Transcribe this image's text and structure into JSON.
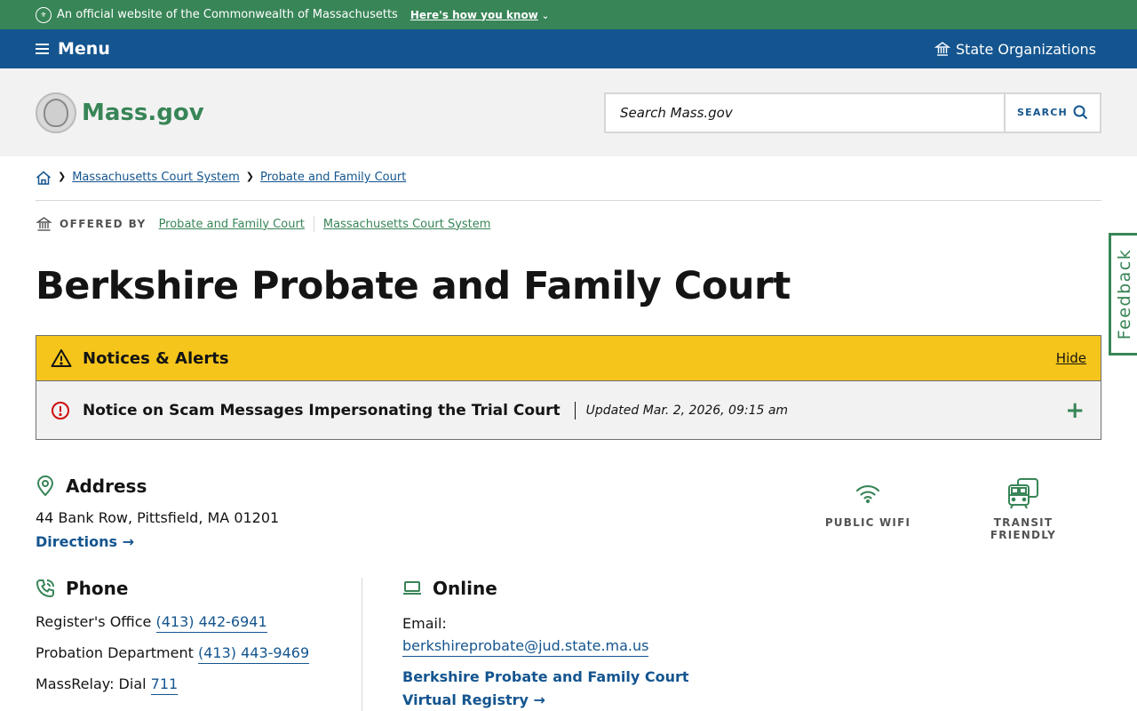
{
  "official_banner": {
    "text": "An official website of the Commonwealth of Massachusetts",
    "how_link": "Here's how you know"
  },
  "nav": {
    "menu_label": "Menu",
    "state_orgs_label": "State Organizations"
  },
  "header": {
    "logo_text": "Mass.gov",
    "search_placeholder": "Search Mass.gov",
    "search_button": "SEARCH"
  },
  "breadcrumb": {
    "items": [
      "Massachusetts Court System",
      "Probate and Family Court"
    ]
  },
  "offered_by": {
    "label": "OFFERED BY",
    "orgs": [
      "Probate and Family Court",
      "Massachusetts Court System"
    ]
  },
  "page": {
    "title": "Berkshire Probate and Family Court"
  },
  "alerts": {
    "title": "Notices & Alerts",
    "hide_label": "Hide",
    "items": [
      {
        "title": "Notice on Scam Messages Impersonating the Trial Court",
        "updated": "Updated Mar. 2, 2026, 09:15 am",
        "expand": "+"
      }
    ]
  },
  "address": {
    "heading": "Address",
    "line": "44 Bank Row, Pittsfield, MA 01201",
    "directions": "Directions →"
  },
  "amenities": [
    {
      "label": "PUBLIC WIFI",
      "icon": "wifi-icon"
    },
    {
      "label": "TRANSIT FRIENDLY",
      "icon": "transit-icon"
    }
  ],
  "phone": {
    "heading": "Phone",
    "rows": [
      {
        "label": "Register's Office",
        "number": "(413) 442-6941"
      },
      {
        "label": "Probation Department",
        "number": "(413) 443-9469"
      },
      {
        "label": "MassRelay: Dial",
        "number": "711"
      }
    ]
  },
  "online": {
    "heading": "Online",
    "email_label": "Email:",
    "email": "berkshireprobate@jud.state.ma.us",
    "registry_line1": "Berkshire Probate and Family Court",
    "registry_line2": "Virtual Registry →"
  },
  "feedback": {
    "label": "Feedback"
  },
  "colors": {
    "green": "#388557",
    "blue": "#14558f",
    "alert_yellow": "#f6c51b",
    "alert_red": "#cd0d0d"
  }
}
